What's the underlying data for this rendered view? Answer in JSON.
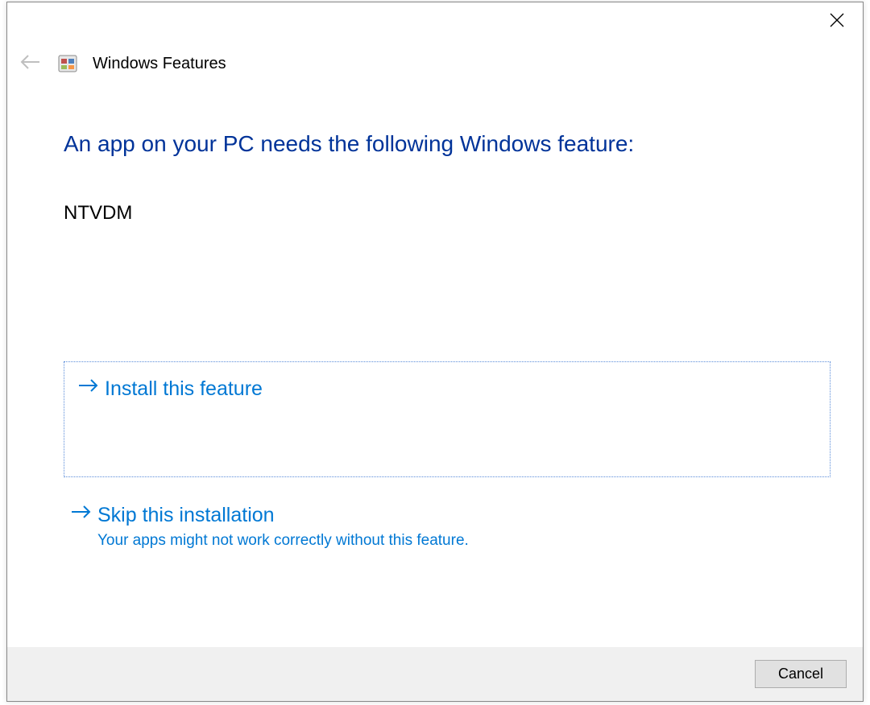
{
  "header": {
    "app_title": "Windows Features"
  },
  "main": {
    "headline": "An app on your PC needs the following Windows feature:",
    "feature_name": "NTVDM"
  },
  "options": {
    "install": {
      "title": "Install this feature"
    },
    "skip": {
      "title": "Skip this installation",
      "subtitle": "Your apps might not work correctly without this feature."
    }
  },
  "footer": {
    "cancel_label": "Cancel"
  }
}
